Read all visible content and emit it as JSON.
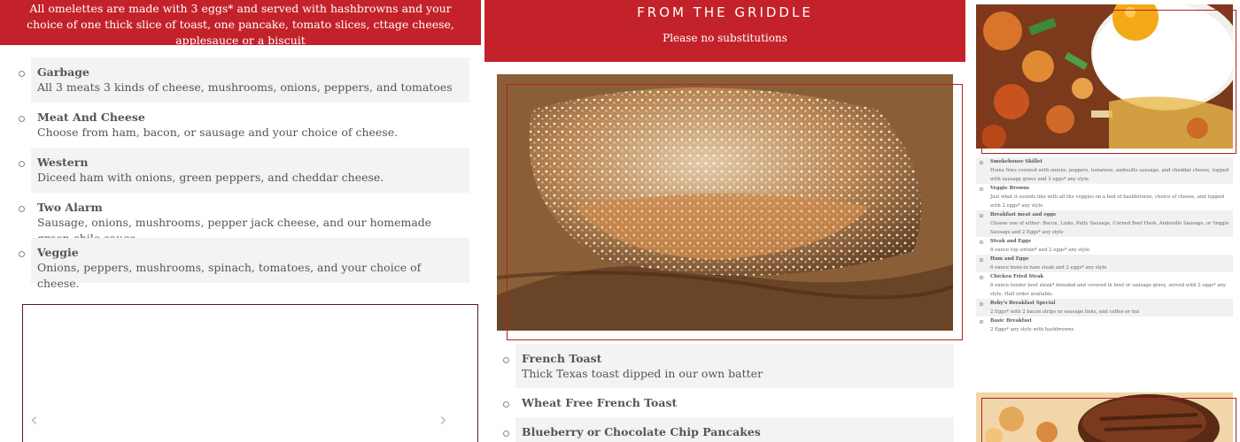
{
  "omelettes": {
    "intro": "All omelettes are made with 3 eggs* and served with hashbrowns and your choice of one thick slice of toast, one pancake, tomato slices, cttage cheese, applesauce or a biscuit",
    "items": [
      {
        "name": "Garbage",
        "desc": "All 3 meats 3 kinds of cheese, mushrooms, onions, peppers, and tomatoes"
      },
      {
        "name": "Meat And Cheese",
        "desc": "Choose from ham, bacon, or sausage and your choice of cheese."
      },
      {
        "name": "Western",
        "desc": "Diceed ham with onions, green peppers, and cheddar cheese."
      },
      {
        "name": "Two Alarm",
        "desc": "Sausage, onions, mushrooms, pepper jack cheese, and our homemade green chile sauce."
      },
      {
        "name": "Veggie",
        "desc": "Onions, peppers, mushrooms, spinach, tomatoes, and your choice of cheese."
      }
    ],
    "carousel": {
      "prev_glyph": "‹",
      "next_glyph": "›"
    }
  },
  "griddle": {
    "title": "FROM THE GRIDDLE",
    "subtitle": "Please no substitutions",
    "items": [
      {
        "name": "French Toast",
        "desc": "Thick Texas toast dipped in our own batter"
      },
      {
        "name": "Wheat Free French Toast",
        "desc": ""
      },
      {
        "name": "Blueberry or Chocolate Chip Pancakes",
        "desc": ""
      }
    ]
  },
  "breakfast_plates": {
    "items": [
      {
        "name": "Smokehouse Skillet",
        "desc": "Home fries covered with onions, peppers, tomatoes, andouille sausage, and cheddar cheese, topped with sausage gravy and 2 eggs* any style"
      },
      {
        "name": "Veggie Browns",
        "desc": "Just what it sounds like with all the veggies on a bed of hashbrowns, choice of cheese, and topped with 2 eggs* any style"
      },
      {
        "name": "Breakfast meat and eggs",
        "desc": "Choose one of either: Bacon, Links, Patty Sausage, Corned Beef Hash, Andouille Sausage, or Veggie Sausage and 2 Eggs* any style"
      },
      {
        "name": "Steak and Eggs",
        "desc": "8 ounce top sirloin* and 2 eggs* any style"
      },
      {
        "name": "Ham and Eggs",
        "desc": "6 ounce bone-in ham steak and 2 eggs* any style"
      },
      {
        "name": "Chicken Fried Steak",
        "desc": "8 ounce tender beef steak* breaded and covered in beef or sausage gravy, served with 2 eggs* any style. Half order available."
      },
      {
        "name": "Roby's Breakfast Special",
        "desc": "2 Eggs* with 2 bacon strips or sausage links, and coffee or tea"
      },
      {
        "name": "Basic Breakfast",
        "desc": "2 Eggs* any style with hashbrowns"
      }
    ]
  },
  "colors": {
    "brand_red": "#c4222a",
    "row_shade": "#f3f3f3"
  }
}
